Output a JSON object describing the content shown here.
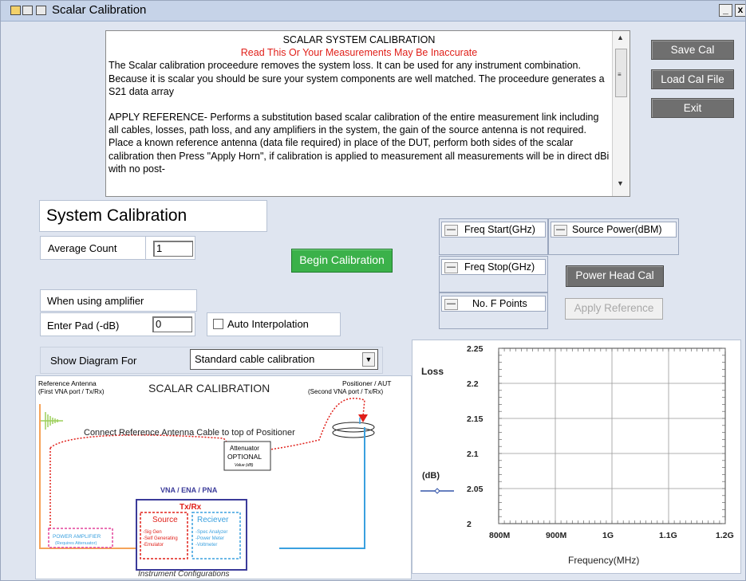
{
  "window": {
    "title": "Scalar Calibration",
    "minimize_label": "_",
    "close_label": "x"
  },
  "info": {
    "heading": "SCALAR SYSTEM CALIBRATION",
    "warning": "Read This Or Your Measurements May Be Inaccurate",
    "para1": " The Scalar calibration proceedure removes the system loss. It can be used for any instrument combination.  Because it is scalar you should be sure your system components are well matched. The proceedure generates a S21 data array",
    "para2": "APPLY REFERENCE- Performs a substitution based scalar calibration of the entire measurement link including all cables, losses, path loss, and any amplifiers in the system, the gain of the source antenna is not required. Place a known reference antenna (data file required) in place of the DUT, perform both sides of the scalar calibration then Press \"Apply Horn\", if calibration is applied to measurement all measurements will be in direct dBi with no post-"
  },
  "buttons": {
    "save_cal": "Save Cal",
    "load_cal_file": "Load Cal File",
    "exit": "Exit",
    "begin_calibration": "Begin Calibration",
    "power_head_cal": "Power Head Cal",
    "apply_reference": "Apply Reference"
  },
  "form": {
    "section_title": "System Calibration",
    "average_count_label": "Average Count",
    "average_count_value": "1",
    "amplifier_note": "When using amplifier",
    "pad_label": "Enter Pad (-dB)",
    "pad_value": "0",
    "auto_interp_label": "Auto Interpolation",
    "show_diagram_label": "Show Diagram For",
    "diagram_select_value": "Standard cable calibration"
  },
  "freq": {
    "start_label": "Freq Start(GHz)",
    "source_power_label": "Source Power(dBM)",
    "stop_label": "Freq Stop(GHz)",
    "points_label": "No. F Points",
    "collapse_label": "—"
  },
  "diagram": {
    "title": "SCALAR CALIBRATION",
    "ref_antenna": "Reference Antenna",
    "ref_antenna_sub": "(First VNA port / Tx/Rx)",
    "positioner": "Positioner / AUT",
    "positioner_sub": "(Second VNA port / Tx/Rx)",
    "connect_note": "Connect Reference Antenna Cable to top of Positioner",
    "attenuator": "Attenuator",
    "optional": "OPTIONAL",
    "value_db": "Value (dB)",
    "vna": "VNA / ENA / PNA",
    "txrx": "Tx/Rx",
    "source": "Source",
    "source_items": [
      "-Sig Gen",
      "-Self Generating",
      "-Emulator"
    ],
    "receiver": "Reciever",
    "receiver_items": [
      "-Spec Analyzer",
      "-Power Meter",
      "-Voltmeter"
    ],
    "power_amp": "POWER AMPLIFIER",
    "power_amp_sub": "(Requires Attenuator)",
    "instrument_configs": "Instrument Configurations",
    "colors": {
      "orange": "#f5a35a",
      "red": "#e0201a",
      "blue": "#3aa0df",
      "pink": "#e4449b",
      "navy": "#3b3b9a"
    }
  },
  "chart_data": {
    "type": "line",
    "title": "",
    "xlabel": "Frequency(MHz)",
    "ylabel": "Loss",
    "ylabel_unit": "(dB)",
    "ylim": [
      2,
      2.25
    ],
    "xlim": [
      800,
      1200
    ],
    "x_tick_labels": [
      "800M",
      "900M",
      "1G",
      "1.1G",
      "1.2G"
    ],
    "y_tick_labels": [
      "2",
      "2.05",
      "2.1",
      "2.15",
      "2.2",
      "2.25"
    ],
    "grid": true,
    "series": [
      {
        "name": "",
        "values": [],
        "color": "#3355aa"
      }
    ]
  }
}
